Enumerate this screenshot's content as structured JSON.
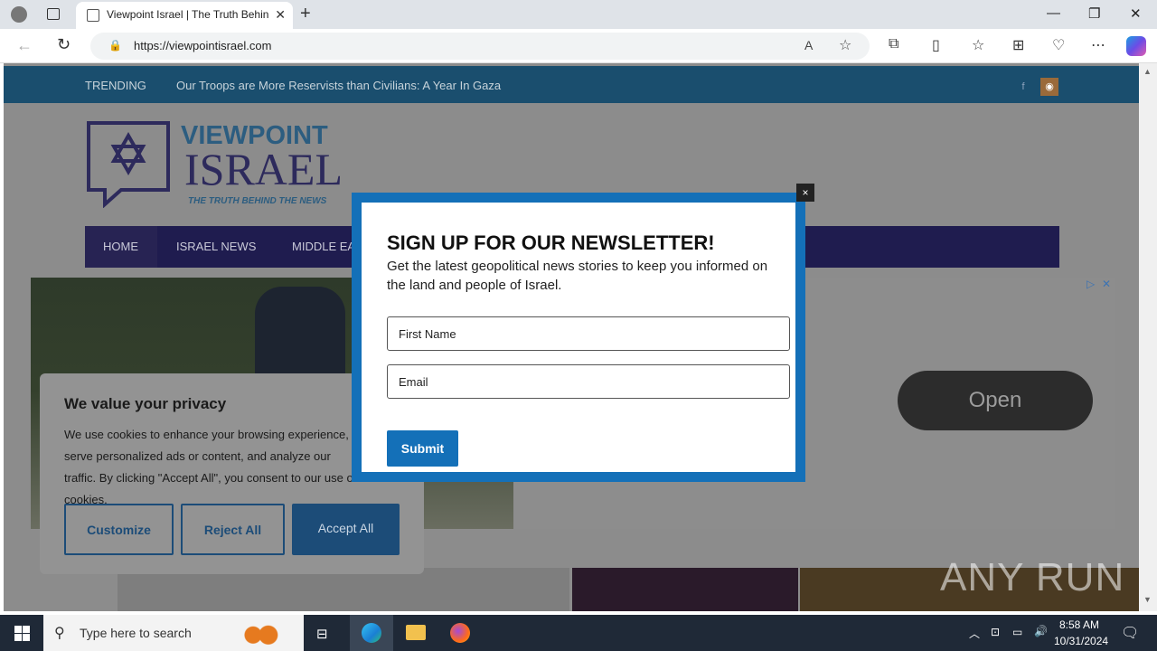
{
  "browser": {
    "tab_title": "Viewpoint Israel | The Truth Behind",
    "url": "https://viewpointisrael.com"
  },
  "site": {
    "trending_label": "TRENDING",
    "trending_headline": "Our Troops are More Reservists than Civilians: A Year In Gaza",
    "logo_line1": "VIEWPOINT",
    "logo_line2": "ISRAEL",
    "logo_tagline": "THE TRUTH BEHIND THE NEWS",
    "nav": [
      "HOME",
      "ISRAEL NEWS",
      "MIDDLE EA"
    ]
  },
  "ad": {
    "open_label": "Open"
  },
  "cookie": {
    "title": "We value your privacy",
    "text": "We use cookies to enhance your browsing experience, serve personalized ads or content, and analyze our traffic. By clicking \"Accept All\", you consent to our use of cookies.",
    "customize": "Customize",
    "reject": "Reject All",
    "accept": "Accept All"
  },
  "newsletter": {
    "title": "SIGN UP FOR OUR NEWSLETTER!",
    "description": "Get the latest geopolitical news stories to keep you informed on the land and people of Israel.",
    "first_name_placeholder": "First Name",
    "email_placeholder": "Email",
    "submit": "Submit",
    "close": "×"
  },
  "taskbar": {
    "search_placeholder": "Type here to search",
    "time": "8:58 AM",
    "date": "10/31/2024"
  },
  "watermark": "ANY RUN"
}
